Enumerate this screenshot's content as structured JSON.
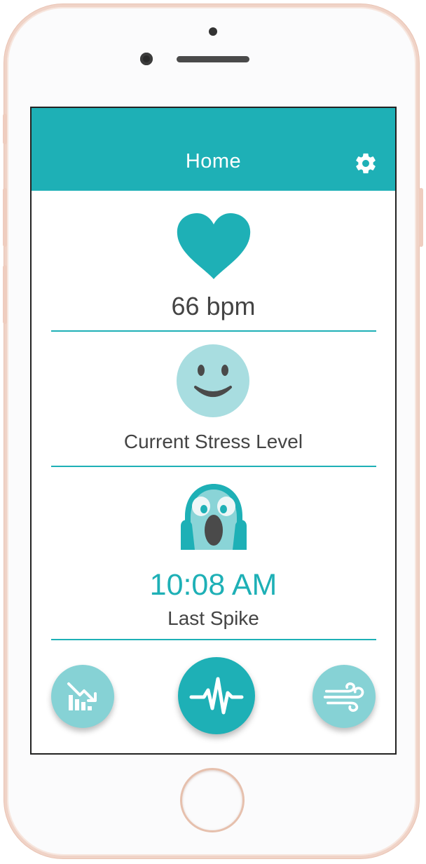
{
  "header": {
    "title": "Home",
    "settings_icon": "gear-icon"
  },
  "heart_rate": {
    "icon": "heart-icon",
    "value": "66 bpm"
  },
  "stress": {
    "icon": "smiley-face-icon",
    "label": "Current Stress Level"
  },
  "spike": {
    "icon": "screaming-face-icon",
    "time": "10:08 AM",
    "label": "Last Spike"
  },
  "nav": {
    "left_icon": "declining-chart-icon",
    "center_icon": "heartbeat-pulse-icon",
    "right_icon": "wind-breathing-icon"
  },
  "colors": {
    "accent": "#1eb0b6",
    "light_accent": "#86d2d5",
    "text": "#444444"
  }
}
